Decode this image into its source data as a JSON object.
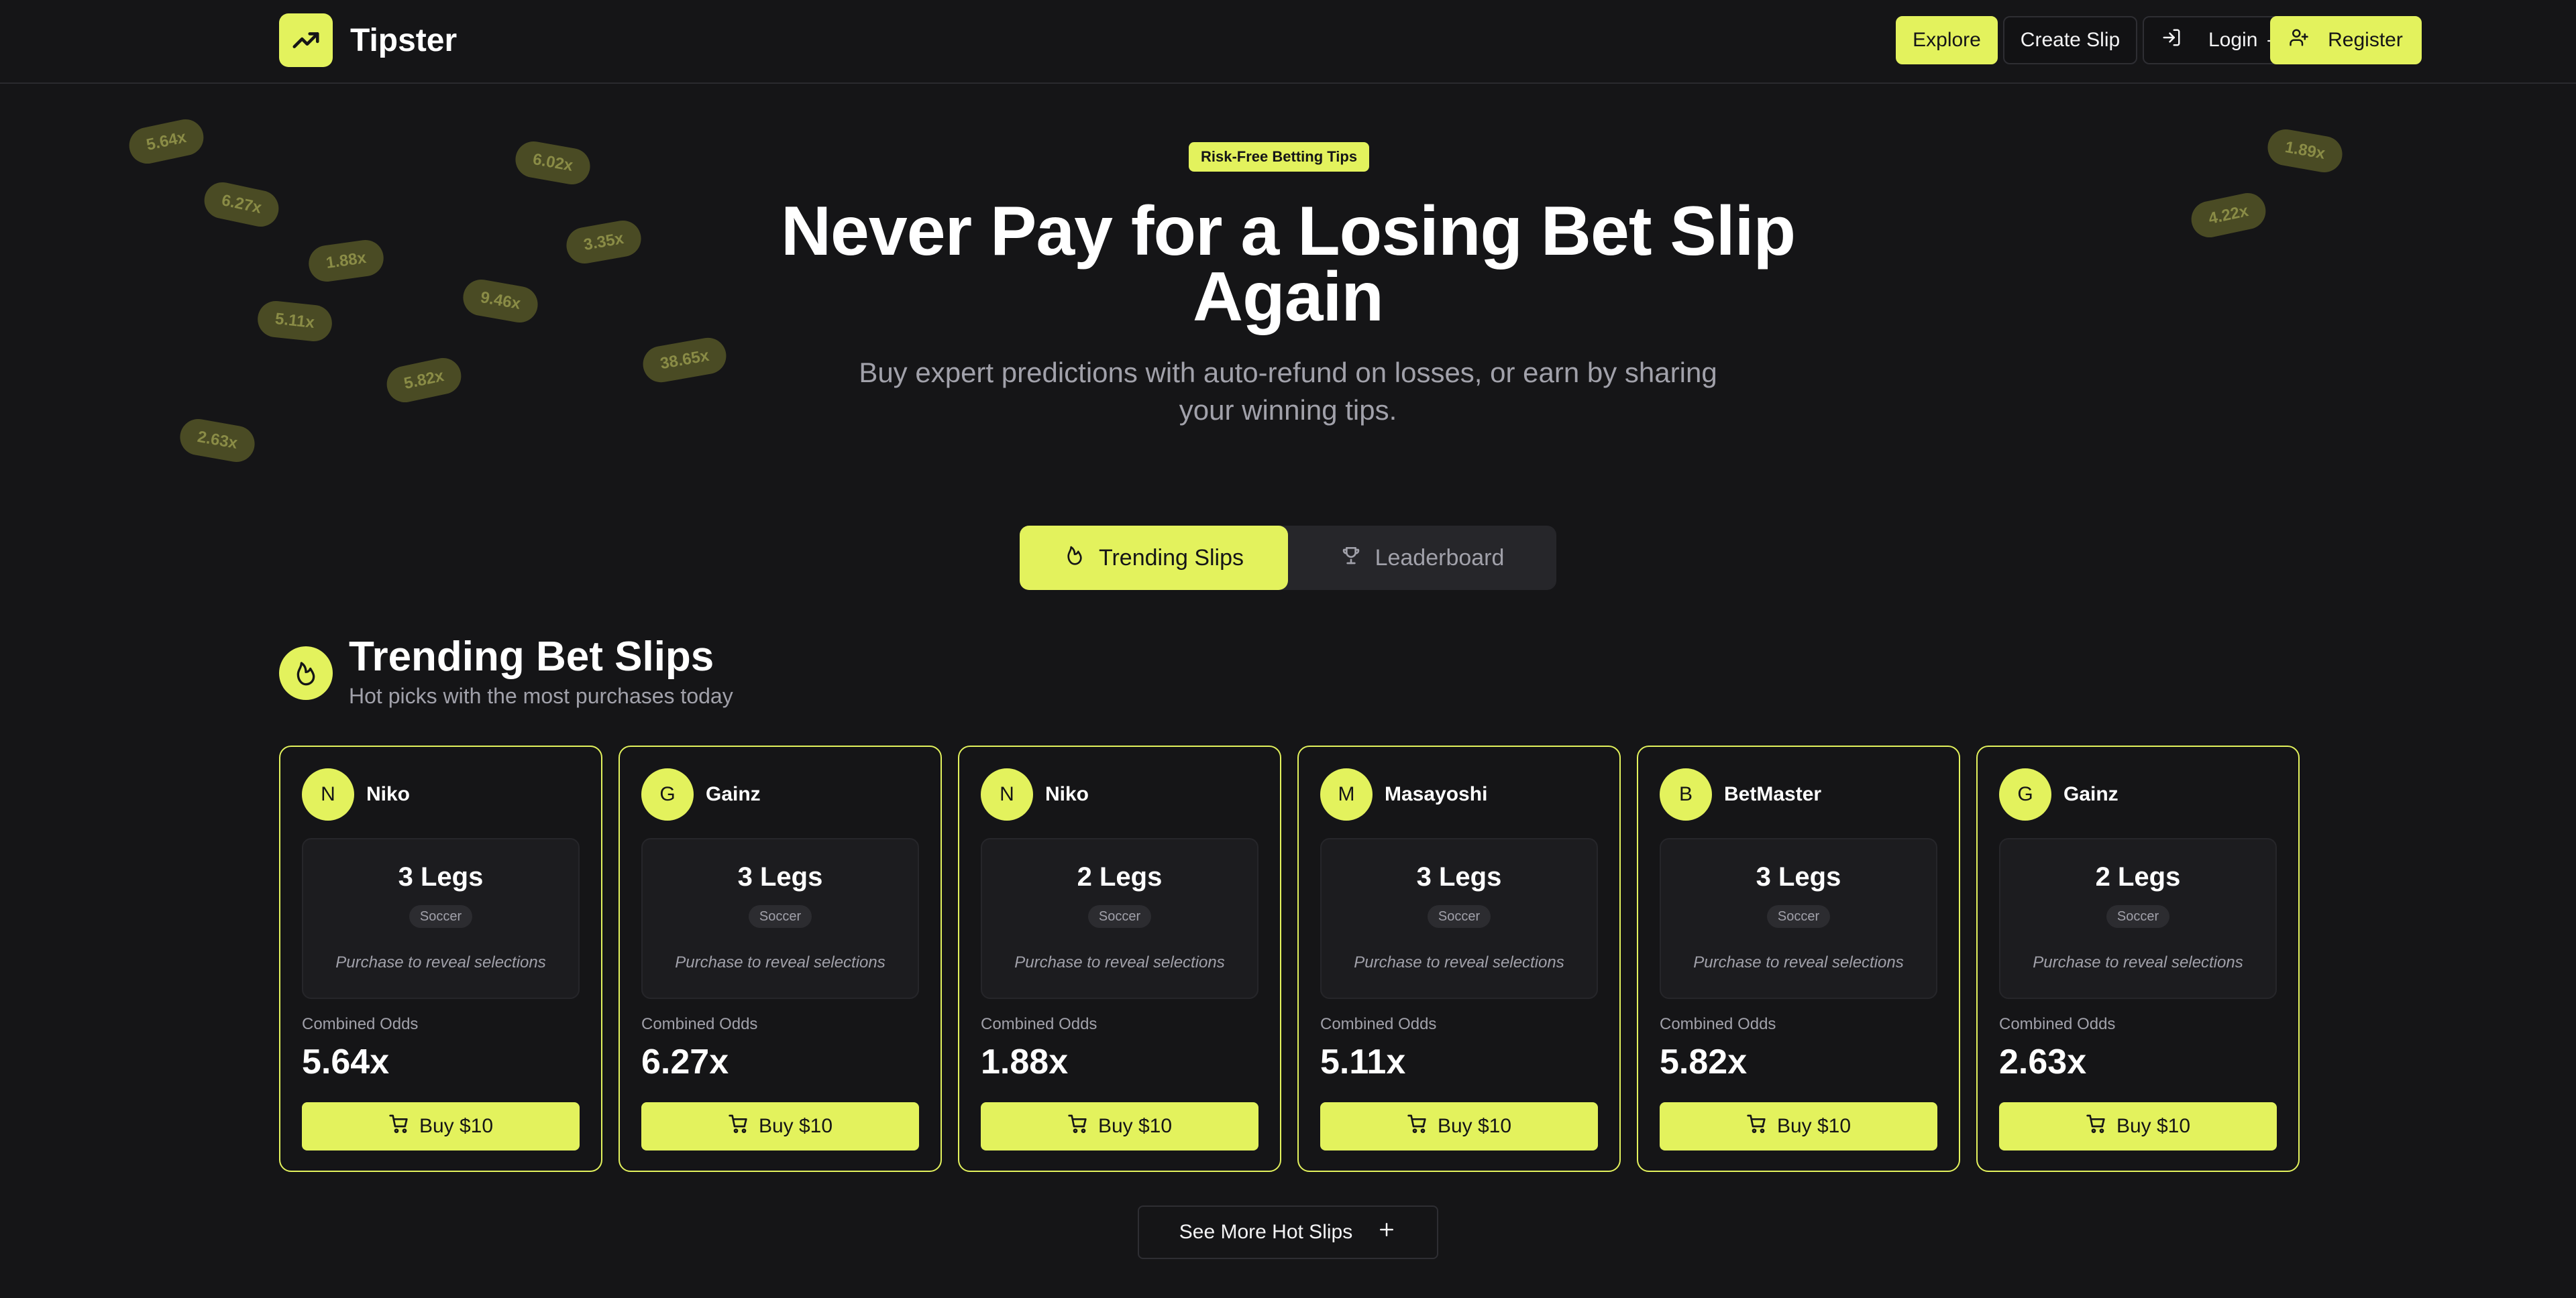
{
  "app": {
    "name": "Tipster"
  },
  "nav": {
    "explore": "Explore",
    "create_slip": "Create Slip",
    "login": "Login",
    "register": "Register"
  },
  "floating_odds": {
    "p1": "5.64x",
    "p2": "6.27x",
    "p3": "1.88x",
    "p4": "5.11x",
    "p5": "5.82x",
    "p6": "2.63x",
    "p7": "6.02x",
    "p8": "3.35x",
    "p9": "9.46x",
    "p10": "38.65x",
    "p11": "1.89x",
    "p12": "4.22x"
  },
  "hero": {
    "badge": "Risk-Free Betting Tips",
    "title": "Never Pay for a Losing Bet Slip Again",
    "subtitle": "Buy expert predictions with auto-refund on losses, or earn by sharing your winning tips."
  },
  "tabs": {
    "trending": "Trending Slips",
    "leaderboard": "Leaderboard"
  },
  "section": {
    "title": "Trending Bet Slips",
    "subtitle": "Hot picks with the most purchases today"
  },
  "cards": [
    {
      "initial": "N",
      "user": "Niko",
      "legs": "3 Legs",
      "sport": "Soccer",
      "reveal": "Purchase to reveal selections",
      "odds_label": "Combined Odds",
      "odds": "5.64x",
      "buy": "Buy $10"
    },
    {
      "initial": "G",
      "user": "Gainz",
      "legs": "3 Legs",
      "sport": "Soccer",
      "reveal": "Purchase to reveal selections",
      "odds_label": "Combined Odds",
      "odds": "6.27x",
      "buy": "Buy $10"
    },
    {
      "initial": "N",
      "user": "Niko",
      "legs": "2 Legs",
      "sport": "Soccer",
      "reveal": "Purchase to reveal selections",
      "odds_label": "Combined Odds",
      "odds": "1.88x",
      "buy": "Buy $10"
    },
    {
      "initial": "M",
      "user": "Masayoshi",
      "legs": "3 Legs",
      "sport": "Soccer",
      "reveal": "Purchase to reveal selections",
      "odds_label": "Combined Odds",
      "odds": "5.11x",
      "buy": "Buy $10"
    },
    {
      "initial": "B",
      "user": "BetMaster",
      "legs": "3 Legs",
      "sport": "Soccer",
      "reveal": "Purchase to reveal selections",
      "odds_label": "Combined Odds",
      "odds": "5.82x",
      "buy": "Buy $10"
    },
    {
      "initial": "G",
      "user": "Gainz",
      "legs": "2 Legs",
      "sport": "Soccer",
      "reveal": "Purchase to reveal selections",
      "odds_label": "Combined Odds",
      "odds": "2.63x",
      "buy": "Buy $10"
    }
  ],
  "see_more": "See More Hot Slips",
  "colors": {
    "accent": "#e3f25d",
    "background": "#151517",
    "muted_text": "#a1a1aa"
  },
  "icons": {
    "logo": "trending-up-icon",
    "login": "log-in-icon",
    "theme": "sun-icon",
    "register": "user-plus-icon",
    "trending_tab": "flame-icon",
    "leaderboard_tab": "trophy-icon",
    "section": "flame-icon",
    "buy": "cart-icon",
    "see_more": "plus-icon"
  }
}
